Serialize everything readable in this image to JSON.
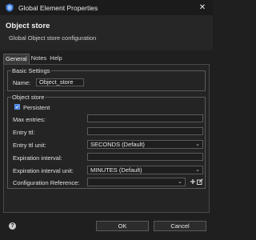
{
  "window": {
    "title": "Global Element Properties",
    "close_glyph": "✕"
  },
  "header": {
    "title": "Object store",
    "subtitle": "Global Object store configuration"
  },
  "tabs": [
    {
      "label": "General",
      "active": true
    },
    {
      "label": "Notes",
      "active": false
    },
    {
      "label": "Help",
      "active": false
    }
  ],
  "basic_settings": {
    "legend": "Basic Settings",
    "name_label": "Name:",
    "name_value": "Object_store"
  },
  "object_store": {
    "legend": "Object store",
    "persistent_label": "Persistent",
    "persistent_checked": true,
    "max_entries_label": "Max entries:",
    "max_entries_value": "",
    "entry_ttl_label": "Entry ttl:",
    "entry_ttl_value": "",
    "entry_ttl_unit_label": "Entry ttl unit:",
    "entry_ttl_unit_value": "SECONDS (Default)",
    "expiration_interval_label": "Expiration interval:",
    "expiration_interval_value": "",
    "expiration_interval_unit_label": "Expiration interval unit:",
    "expiration_interval_unit_value": "MINUTES (Default)",
    "config_ref_label": "Configuration Reference:",
    "config_ref_value": ""
  },
  "footer": {
    "ok_label": "OK",
    "cancel_label": "Cancel",
    "help_glyph": "?"
  },
  "colors": {
    "accent": "#3f7de0",
    "background": "#1f1f1f",
    "panel": "#242424"
  }
}
